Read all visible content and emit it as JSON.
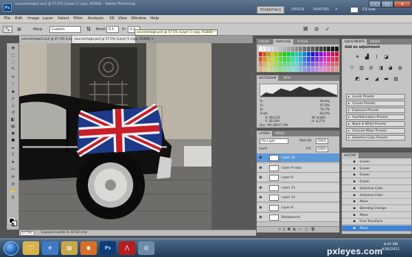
{
  "titlebar": {
    "title": "sourceimage1.psd @ 57.5% (Layer 5 copy, RGB/8) - Adobe Photoshop",
    "ps_logo": "Ps",
    "workspaces": [
      "ESSENTIALS",
      "DESIGN",
      "PAINTING"
    ],
    "cs_live": "CS Live"
  },
  "menu": [
    "File",
    "Edit",
    "Image",
    "Layer",
    "Select",
    "Filter",
    "Analysis",
    "3D",
    "View",
    "Window",
    "Help"
  ],
  "options": {
    "style_label": "Warp:",
    "style_value": "Custom",
    "h_value": "0.0",
    "v_value": "0.0"
  },
  "tabs": [
    {
      "label": "sourceimage1.psd @ 47.3% (Layer 14, RGB/8) ×"
    },
    {
      "label": "sourceimage.psd @ 57.5% (Layer 5 copy, RGB/8) ×"
    }
  ],
  "tooltip": "sourceimage.psd @ 57.5% (Layer 5 copy, RGB/8) *",
  "status": {
    "zoom": "57.5%",
    "message": "Exposure works in 32-bit only"
  },
  "panels": {
    "color_tabs": [
      "COLOR",
      "SWATCHES",
      "STYLES"
    ],
    "info_tabs": [
      "HISTOGRAM",
      "INFO"
    ],
    "info": {
      "r": "R:",
      "g": "G:",
      "b": "B:",
      "bit": "8-bit",
      "c_val": "99.8%",
      "m_val": "97.8%",
      "y_val": "74.7%",
      "k_val": "60.0%",
      "x_label": "X:",
      "x_val": "48.233",
      "y_label": "Y:",
      "y_pos": "28.269",
      "w_label": "W:",
      "w_val": "8.064",
      "h_label": "H:",
      "h_val": "4.274"
    },
    "doc_size": "Doc: 99.3M/57.2M",
    "layer_tabs": [
      "LAYERS",
      "PATHS"
    ],
    "blend_mode": "Pin Light",
    "opacity_label": "Opacity:",
    "opacity_value": "100%",
    "fill_label": "Fill:",
    "fill_value": "100%",
    "lock_label": "Lock:",
    "layers": [
      {
        "name": "Layer 14",
        "selected": true
      },
      {
        "name": "Layer 9 copy",
        "selected": false
      },
      {
        "name": "Layer 9",
        "selected": false
      },
      {
        "name": "Layer 11",
        "selected": false
      },
      {
        "name": "Layer 13",
        "selected": false
      },
      {
        "name": "Layer 8",
        "selected": false
      },
      {
        "name": "Background",
        "selected": false
      }
    ],
    "adj_tabs": [
      "ADJUSTMENTS",
      "MASKS"
    ],
    "adj_title": "Add an adjustment",
    "presets": [
      "Levels Presets",
      "Curves Presets",
      "Exposure Presets",
      "Hue/Saturation Presets",
      "Black & White Presets",
      "Channel Mixer Presets",
      "Selective Color Presets"
    ],
    "history_tab": "HISTORY",
    "history": [
      {
        "label": "Eraser",
        "selected": false
      },
      {
        "label": "Eraser",
        "selected": false
      },
      {
        "label": "Eraser",
        "selected": false
      },
      {
        "label": "Eraser",
        "selected": false
      },
      {
        "label": "Selective Color",
        "selected": false
      },
      {
        "label": "Selective Color",
        "selected": false
      },
      {
        "label": "Move",
        "selected": false
      },
      {
        "label": "Blending Change",
        "selected": false
      },
      {
        "label": "Move",
        "selected": false
      },
      {
        "label": "Free Transform",
        "selected": false
      },
      {
        "label": "Move",
        "selected": true
      }
    ]
  },
  "taskbar": {
    "clock_time": "4:07 PM",
    "clock_date": "4/30/2012",
    "ps_icon": "Ps"
  },
  "watermark": "pxleyes.com"
}
